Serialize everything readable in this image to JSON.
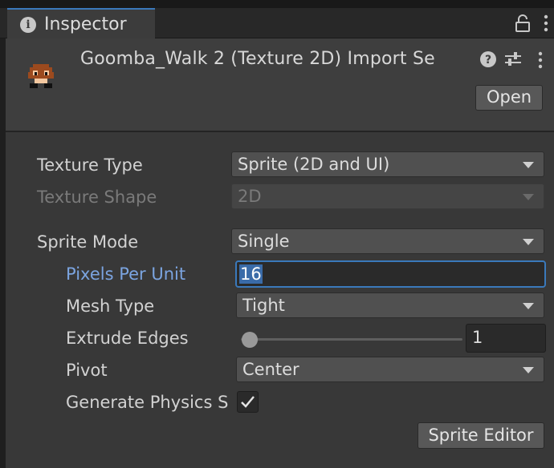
{
  "window": {
    "tab_label": "Inspector",
    "tab_icon": "info-icon",
    "lock_icon": "lock-icon",
    "menu_icon": "more-vertical-icon"
  },
  "header": {
    "title": "Goomba_Walk 2 (Texture 2D) Import Se",
    "asset_icon": "goomba-sprite-icon",
    "help_icon": "help-icon",
    "preset_icon": "preset-sliders-icon",
    "menu_icon": "more-vertical-icon",
    "open_label": "Open"
  },
  "fields": {
    "texture_type": {
      "label": "Texture Type",
      "value": "Sprite (2D and UI)"
    },
    "texture_shape": {
      "label": "Texture Shape",
      "value": "2D",
      "disabled": true
    },
    "sprite_mode": {
      "label": "Sprite Mode",
      "value": "Single"
    },
    "pixels_per_unit": {
      "label": "Pixels Per Unit",
      "value": "16",
      "focused": true
    },
    "mesh_type": {
      "label": "Mesh Type",
      "value": "Tight"
    },
    "extrude_edges": {
      "label": "Extrude Edges",
      "value": "1",
      "slider_fraction": 0.03
    },
    "pivot": {
      "label": "Pivot",
      "value": "Center"
    },
    "generate_physics_shape": {
      "label": "Generate Physics S",
      "checked": true
    }
  },
  "footer": {
    "sprite_editor_label": "Sprite Editor"
  },
  "colors": {
    "accent": "#3a79bb",
    "active_label": "#7ba4e0",
    "panel_bg": "#383838"
  }
}
